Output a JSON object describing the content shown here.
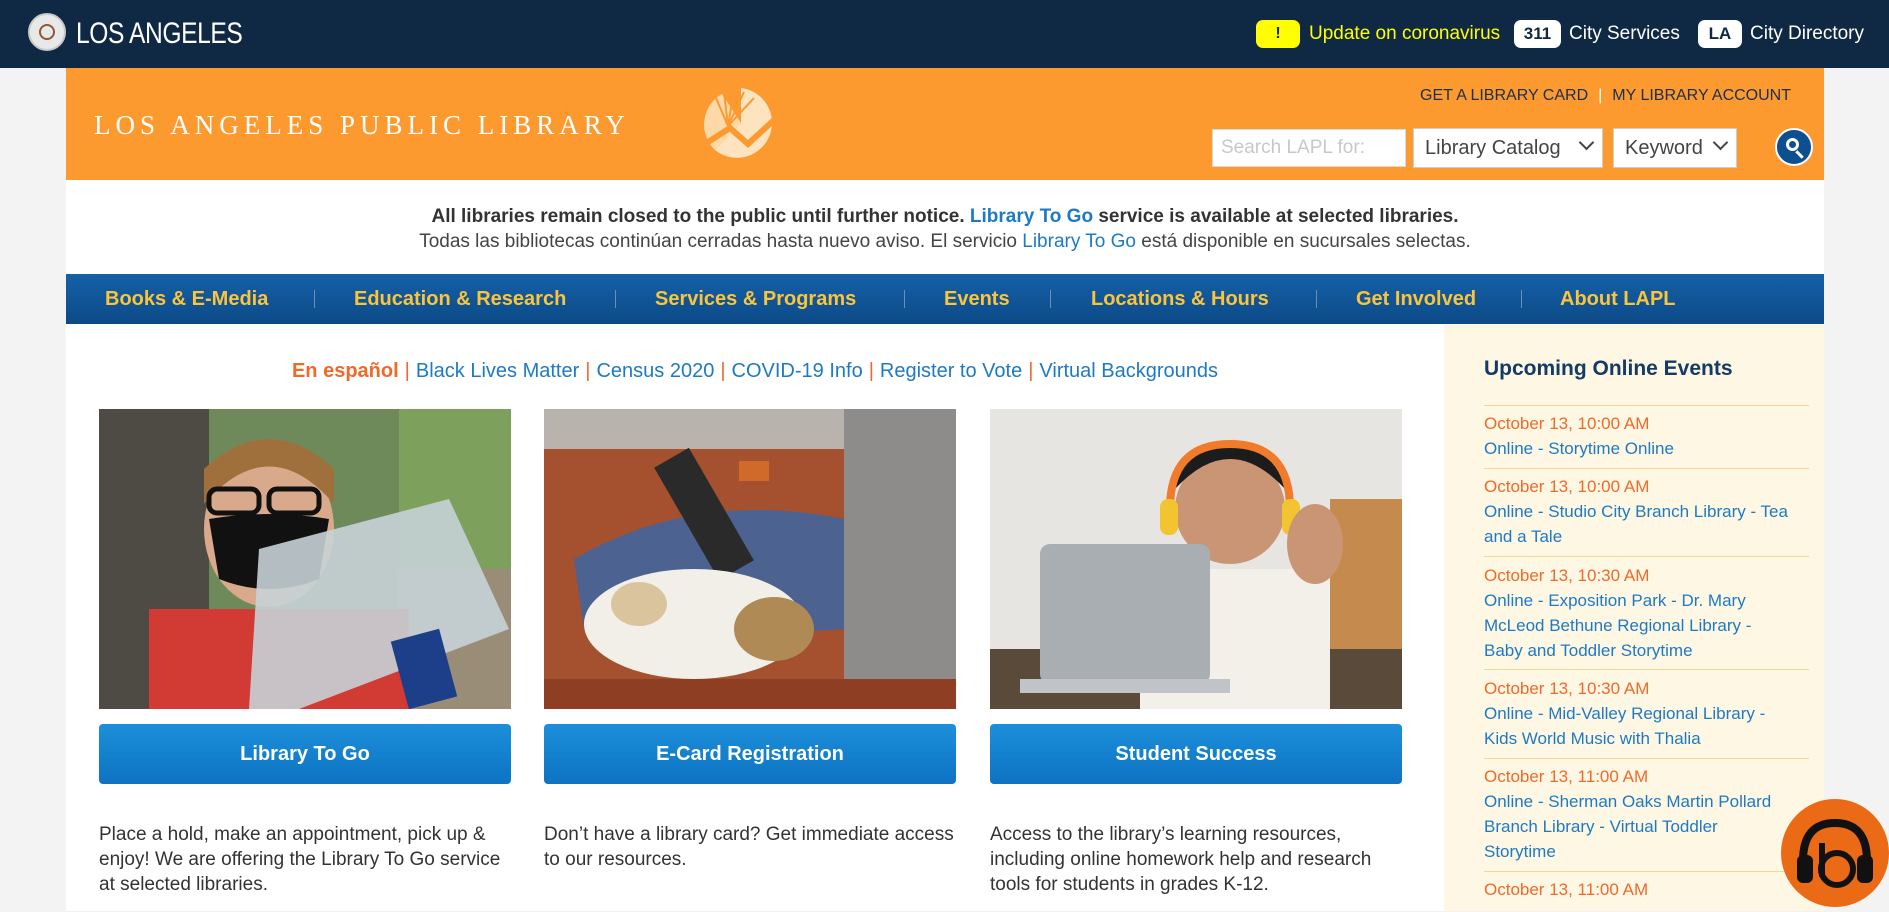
{
  "citybar": {
    "city_name": "LOS ANGELES",
    "covid_badge": "!",
    "covid_link": "Update on coronavirus",
    "services_badge": "311",
    "services_label": "City Services",
    "directory_badge": "LA",
    "directory_label": "City Directory"
  },
  "header": {
    "wordmark": "LOS ANGELES PUBLIC LIBRARY",
    "get_card": "GET A LIBRARY CARD",
    "my_account": "MY LIBRARY ACCOUNT",
    "search_placeholder": "Search LAPL for:",
    "catalog_select": "Library Catalog",
    "keyword_select": "Keyword",
    "colors": {
      "orange": "#fc9a2f",
      "navy": "#0f2844"
    }
  },
  "notice": {
    "line1_pre": "All libraries remain closed to the public until further notice. ",
    "line1_link": "Library To Go",
    "line1_post": " service is available at selected libraries.",
    "line2_pre": "Todas las bibliotecas continúan cerradas hasta nuevo aviso. El servicio ",
    "line2_link": "Library To Go",
    "line2_post": " está disponible en sucursales selectas."
  },
  "nav": {
    "items": [
      "Books & E-Media",
      "Education & Research",
      "Services & Programs",
      "Events",
      "Locations & Hours",
      "Get Involved",
      "About LAPL"
    ]
  },
  "quicklinks": {
    "spanish": "En español",
    "sep": "|",
    "links": [
      "Black Lives Matter",
      "Census 2020",
      "COVID-19 Info",
      "Register to Vote",
      "Virtual Backgrounds"
    ]
  },
  "cards": [
    {
      "button": "Library To Go",
      "text": "Place a hold, make an appointment, pick up & enjoy! We are offering the Library To Go service at selected libraries."
    },
    {
      "button": "E-Card Registration",
      "text": "Don’t have a library card? Get immediate access to our resources."
    },
    {
      "button": "Student Success",
      "text": "Access to the library’s learning resources, including online homework help and research tools for students in grades K-12."
    }
  ],
  "events": {
    "title": "Upcoming Online Events",
    "items": [
      {
        "date": "October 13, 10:00 AM",
        "l1": "Online - Storytime Online",
        "l2": "",
        "l3": ""
      },
      {
        "date": "October 13, 10:00 AM",
        "l1": "Online - Studio City Branch Library - Tea",
        "l2": "and a Tale",
        "l3": ""
      },
      {
        "date": "October 13, 10:30 AM",
        "l1": "Online - Exposition Park - Dr. Mary",
        "l2": "McLeod Bethune Regional Library -",
        "l3": "Baby and Toddler Storytime"
      },
      {
        "date": "October 13, 10:30 AM",
        "l1": "Online - Mid-Valley Regional Library -",
        "l2": "Kids World Music with Thalia",
        "l3": ""
      },
      {
        "date": "October 13, 11:00 AM",
        "l1": "Online - Sherman Oaks Martin Pollard",
        "l2": "Branch Library - Virtual Toddler",
        "l3": "Storytime"
      },
      {
        "date": "October 13, 11:00 AM",
        "l1": "",
        "l2": "",
        "l3": ""
      }
    ]
  }
}
